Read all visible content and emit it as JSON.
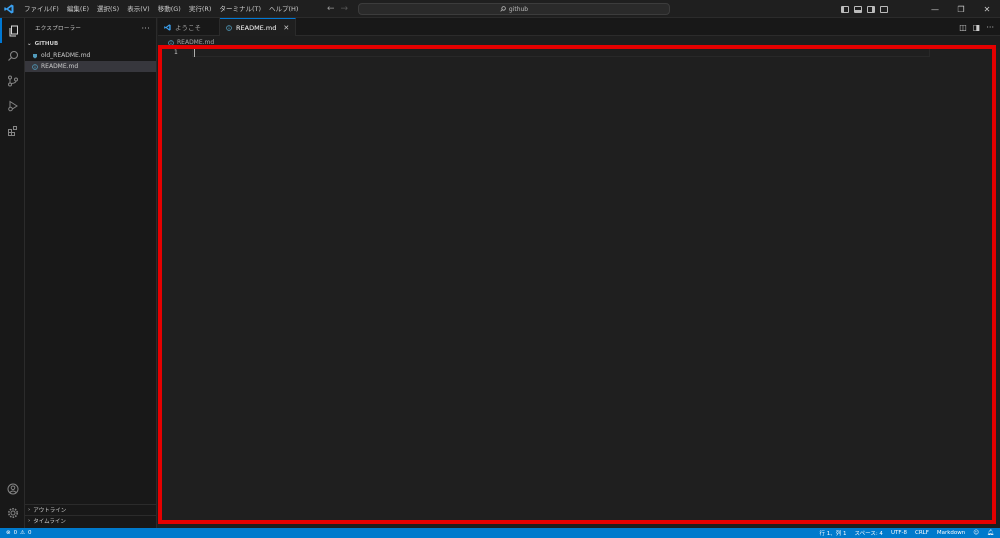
{
  "titlebar": {
    "menu": [
      "ファイル(F)",
      "編集(E)",
      "選択(S)",
      "表示(V)",
      "移動(G)",
      "実行(R)",
      "ターミナル(T)",
      "ヘルプ(H)"
    ],
    "search": "github"
  },
  "sidebar": {
    "title": "エクスプローラー",
    "more": "···",
    "folder": "GITHUB",
    "files": [
      {
        "name": "old_README.md",
        "icon": "markdown-icon"
      },
      {
        "name": "README.md",
        "icon": "info-icon"
      }
    ],
    "outline": "アウトライン",
    "timeline": "タイムライン"
  },
  "editor": {
    "tabs": [
      {
        "label": "ようこそ",
        "active": false
      },
      {
        "label": "README.md",
        "active": true
      }
    ],
    "breadcrumb": "README.md",
    "line_number": "1"
  },
  "statusbar": {
    "errors": "0",
    "warnings": "0",
    "position": "行 1、列 1",
    "spaces": "スペース: 4",
    "encoding": "UTF-8",
    "eol": "CRLF",
    "language": "Markdown"
  },
  "colors": {
    "accent": "#0078d4",
    "statusbar": "#007acc",
    "highlight": "#e50000"
  }
}
